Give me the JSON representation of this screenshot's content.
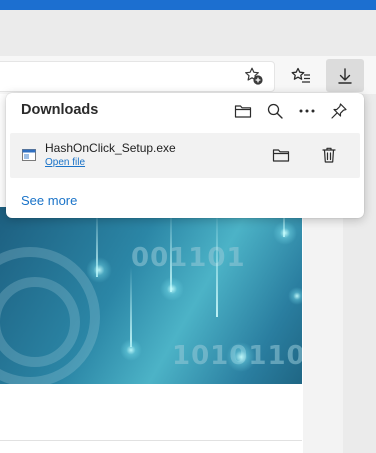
{
  "browser": {
    "toolbar": {
      "add_favorite_icon": "star-plus-icon",
      "favorites_icon": "favorites-list-icon",
      "downloads_icon": "download-arrow-icon"
    }
  },
  "downloads_panel": {
    "title": "Downloads",
    "header_icons": [
      "folder-icon",
      "search-icon",
      "more-icon",
      "pin-icon"
    ],
    "items": [
      {
        "file_name": "HashOnClick_Setup.exe",
        "action_label": "Open file",
        "icons": [
          "folder-icon",
          "trash-icon"
        ]
      }
    ],
    "see_more_label": "See more"
  },
  "page": {
    "hero_binary_1": "001101",
    "hero_binary_2": "1010110"
  },
  "colors": {
    "accent_blue": "#1a73c8",
    "title_bar_blue": "#1c6fd0",
    "item_background": "#f2f2f2"
  }
}
